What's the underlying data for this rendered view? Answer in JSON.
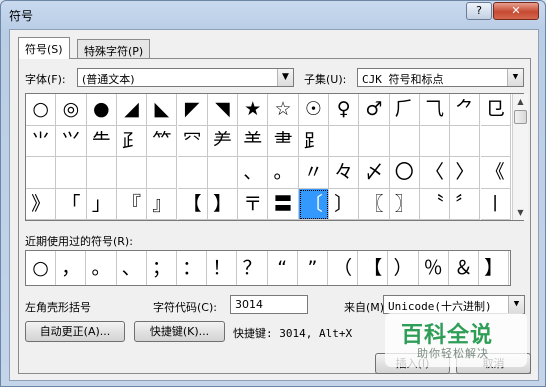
{
  "window": {
    "title": "符号",
    "help_label": "?",
    "close_label": "✕"
  },
  "tabs": [
    {
      "label": "符号(S)"
    },
    {
      "label": "特殊字符(P)"
    }
  ],
  "font": {
    "label": "字体(F):",
    "value": "(普通文本)"
  },
  "subset": {
    "label": "子集(U):",
    "value": "CJK 符号和标点"
  },
  "symbol_grid": {
    "rows": [
      [
        "○",
        "◎",
        "●",
        "◢",
        "◣",
        "◤",
        "◥",
        "★",
        "☆",
        "☉",
        "♀",
        "♂",
        "⺁",
        "⺄",
        "⺈",
        "⺋"
      ],
      [
        "⺌",
        "⺍",
        "⺧",
        "⺪",
        "⺮",
        "⺳",
        "⺶",
        "⺷",
        "⺻",
        "⻊",
        "",
        "",
        "",
        "",
        "",
        ""
      ],
      [
        "",
        "",
        "",
        "",
        "",
        "",
        "",
        "、",
        "。",
        "〃",
        "々",
        "〆",
        "〇",
        "〈",
        "〉",
        "《"
      ],
      [
        "》",
        "「",
        "」",
        "『",
        "』",
        "【",
        "】",
        "〒",
        "〓",
        "〔",
        "〕",
        "〖",
        "〗",
        "〝",
        "〞",
        "〡"
      ]
    ],
    "selected": [
      3,
      9
    ]
  },
  "recent": {
    "label": "近期使用过的符号(R):",
    "symbols": [
      "○",
      "，",
      "。",
      "、",
      "；",
      "：",
      "！",
      "？",
      "“",
      "”",
      "（",
      "【",
      "）",
      "％",
      "＆",
      "】"
    ]
  },
  "char_name": "左角壳形括号",
  "char_code": {
    "label": "字符代码(C):",
    "value": "3014"
  },
  "from": {
    "label": "来自(M):",
    "value": "Unicode(十六进制)"
  },
  "autocorrect_button": "自动更正(A)...",
  "shortcut_button": "快捷键(K)...",
  "shortcut_text": "快捷键: 3014, Alt+X",
  "insert_button": "插入(I)",
  "cancel_button": "取消",
  "watermark": {
    "title": "百科全说",
    "subtitle": "助你轻松解决"
  }
}
